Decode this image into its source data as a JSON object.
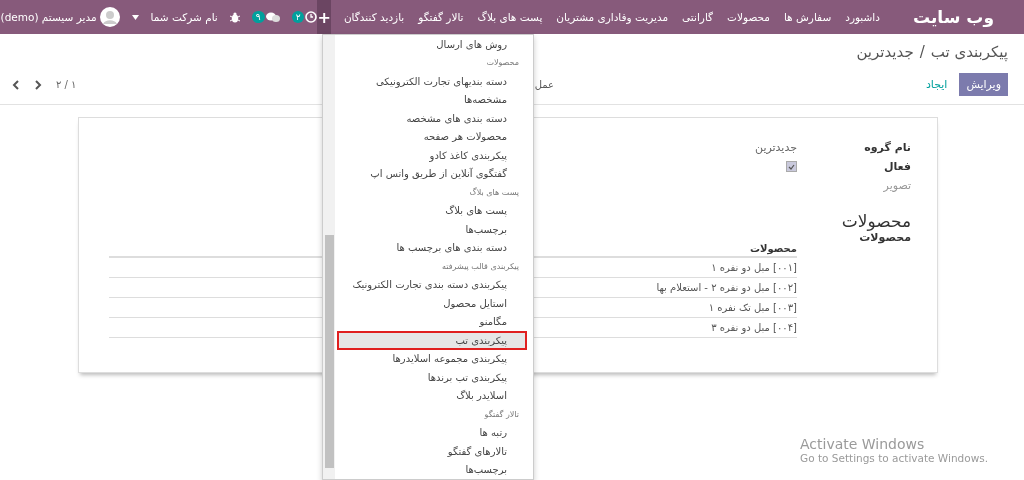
{
  "navbar": {
    "brand": "وب سایت",
    "menu": [
      "داشبورد",
      "سفارش ها",
      "محصولات",
      "گارانتی",
      "مدیریت وفاداری مشتریان",
      "پست های بلاگ",
      "تالار گفتگو",
      "بازدید کنندگان"
    ],
    "quick_create": "+",
    "activity_count": "۲",
    "message_count": "۹",
    "company": "نام شرکت شما",
    "user": "مدیر سیستم (demo)"
  },
  "breadcrumb": [
    "پیکربندی تب",
    "جدیدترین"
  ],
  "breadcrumb_separator": "/",
  "buttons": {
    "edit": "ویرایش",
    "create": "ایجاد",
    "action": "عمل"
  },
  "pager": "۱ / ۲",
  "form": {
    "fields": [
      {
        "label": "نام گروه",
        "kind": "text",
        "value": "جدیدترین"
      },
      {
        "label": "فعال",
        "kind": "checkbox",
        "checked": true
      },
      {
        "label": "تصویر",
        "kind": "empty"
      }
    ],
    "section_title": "محصولات",
    "section_label": "محصولات",
    "table": {
      "columns": [
        "محصولات"
      ],
      "rows": [
        "[۰۰۱] مبل دو نفره ۱",
        "[۰۰۲] مبل دو نفره ۲ - استعلام بها",
        "[۰۰۳] مبل تک نفره ۱",
        "[۰۰۴] مبل دو نفره ۳"
      ]
    }
  },
  "dropdown": {
    "items": [
      {
        "label": "روش های ارسال",
        "kind": "item",
        "selected": false
      },
      {
        "label": "محصولات",
        "kind": "header"
      },
      {
        "label": "دسته بندیهای تجارت الکترونیکی",
        "kind": "item",
        "selected": false
      },
      {
        "label": "مشخصه‌ها",
        "kind": "item",
        "selected": false
      },
      {
        "label": "دسته بندی های مشخصه",
        "kind": "item",
        "selected": false
      },
      {
        "label": "محصولات هر صفحه",
        "kind": "item",
        "selected": false
      },
      {
        "label": "پیکربندی کاغذ کادو",
        "kind": "item",
        "selected": false
      },
      {
        "label": "گفتگوی آنلاین از طریق واتس اپ",
        "kind": "item",
        "selected": false
      },
      {
        "label": "پست های بلاگ",
        "kind": "header"
      },
      {
        "label": "پست های بلاگ",
        "kind": "item",
        "selected": false
      },
      {
        "label": "برچسب‌ها",
        "kind": "item",
        "selected": false
      },
      {
        "label": "دسته بندی های برچسب ها",
        "kind": "item",
        "selected": false
      },
      {
        "label": "پیکربندی قالب پیشرفته",
        "kind": "header"
      },
      {
        "label": "پیکربندی دسته بندی تجارت الکترونیک",
        "kind": "item",
        "selected": false
      },
      {
        "label": "استایل محصول",
        "kind": "item",
        "selected": false
      },
      {
        "label": "مگامنو",
        "kind": "item",
        "selected": false
      },
      {
        "label": "پیکربندی تب",
        "kind": "item",
        "selected": true
      },
      {
        "label": "پیکربندی مجموعه اسلایدرها",
        "kind": "item",
        "selected": false
      },
      {
        "label": "پیکربندی تب برندها",
        "kind": "item",
        "selected": false
      },
      {
        "label": "اسلایدر بلاگ",
        "kind": "item",
        "selected": false
      },
      {
        "label": "تالار گفتگو",
        "kind": "header"
      },
      {
        "label": "رتبه ها",
        "kind": "item",
        "selected": false
      },
      {
        "label": "تالارهای گفتگو",
        "kind": "item",
        "selected": false
      },
      {
        "label": "برچسب‌ها",
        "kind": "item",
        "selected": false
      }
    ]
  },
  "os_notice": {
    "title": "Activate Windows",
    "text": "Go to Settings to activate Windows."
  }
}
